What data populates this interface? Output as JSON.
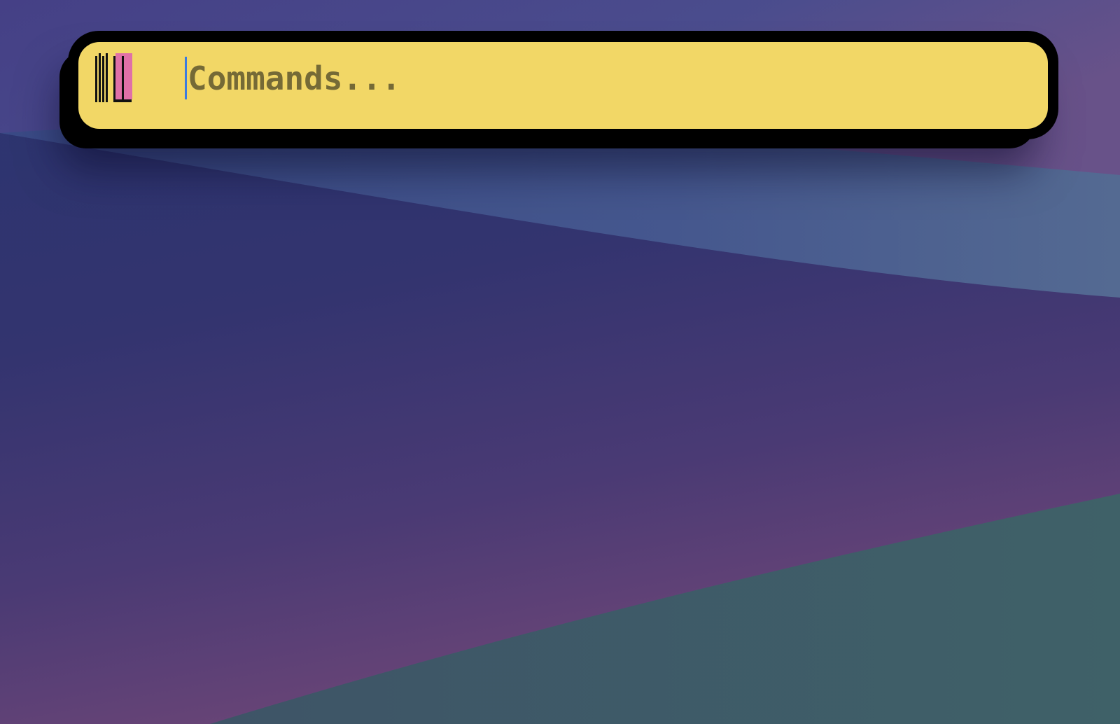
{
  "desktop": {
    "wallpaper_colors": {
      "top": "#4a4a8c",
      "mid": "#2d2f6a",
      "lower": "#4f3a75",
      "bottom_left": "#6a4577",
      "teal_band": "#3e5f6a",
      "highlight_band": "#4f6590"
    }
  },
  "palette": {
    "background": "#f2d766",
    "frame_color": "#000000",
    "cursor_color": "#3b7be0",
    "logo": {
      "icon": "app-logo-icon",
      "stripe_colors": [
        "#111111",
        "#e070a8"
      ]
    },
    "search": {
      "placeholder": "Commands...",
      "value": ""
    }
  }
}
